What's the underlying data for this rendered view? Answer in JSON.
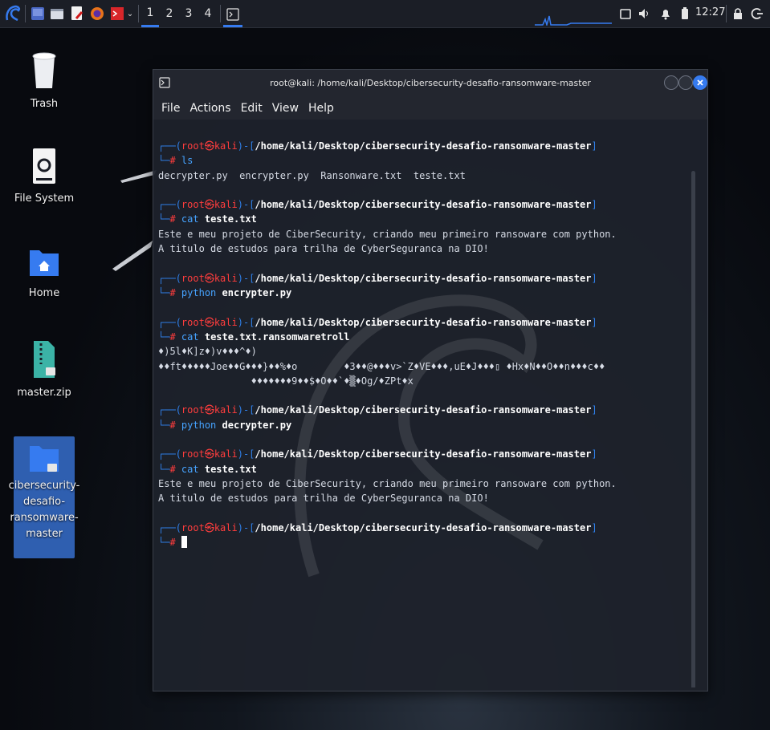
{
  "panel": {
    "workspaces": [
      "1",
      "2",
      "3",
      "4"
    ],
    "active_workspace": "1",
    "clock": "12:27"
  },
  "desktop": {
    "icons": [
      {
        "label": "Trash"
      },
      {
        "label": "File System"
      },
      {
        "label": "Home"
      },
      {
        "label": "master.zip"
      },
      {
        "label": "cibersecurity-\ndesafio-\nransomware-\nmaster"
      }
    ]
  },
  "window": {
    "title": "root@kali: /home/kali/Desktop/cibersecurity-desafio-ransomware-master",
    "menu": [
      "File",
      "Actions",
      "Edit",
      "View",
      "Help"
    ]
  },
  "terminal": {
    "prompt": {
      "user": "root",
      "at": "㉿",
      "host": "kali",
      "path": "/home/kali/Desktop/cibersecurity-desafio-ransomware-master",
      "symbol": "#"
    },
    "blocks": [
      {
        "cmd": "ls",
        "arg": "",
        "output": [
          "decrypter.py  encrypter.py  Ransonware.txt  teste.txt"
        ]
      },
      {
        "cmd": "cat",
        "arg": "teste.txt",
        "output": [
          "Este e meu projeto de CiberSecurity, criando meu primeiro ransoware com python.",
          "A titulo de estudos para trilha de CyberSeguranca na DIO!"
        ]
      },
      {
        "cmd": "python",
        "arg": "encrypter.py",
        "output": []
      },
      {
        "cmd": "cat",
        "arg": "teste.txt.ransomwaretroll",
        "output": [
          "♦)5l♦K]z♦)v♦♦♦^♦)",
          "♦♦ft♦♦♦♦♦Joe♦♦G♦♦♦}♦♦%♦o        ♦3♦♦@♦♦♦v>`Z♦VE♦♦♦,uE♦J♦♦♦▯ ♦Hx♦N♦♦O♦♦n♦♦♦c♦♦",
          "                ♦♦♦♦♦♦♦9♦♦$♦O♦♦`♦▒♦Og/♦ZPt♦x"
        ]
      },
      {
        "cmd": "python",
        "arg": "decrypter.py",
        "output": []
      },
      {
        "cmd": "cat",
        "arg": "teste.txt",
        "output": [
          "Este e meu projeto de CiberSecurity, criando meu primeiro ransoware com python.",
          "A titulo de estudos para trilha de CyberSeguranca na DIO!"
        ]
      }
    ]
  },
  "colors": {
    "accent": "#367bf0",
    "prompt_blue": "#2f7fe8",
    "prompt_red": "#ff3d3d",
    "command_blue": "#46a3ff"
  }
}
